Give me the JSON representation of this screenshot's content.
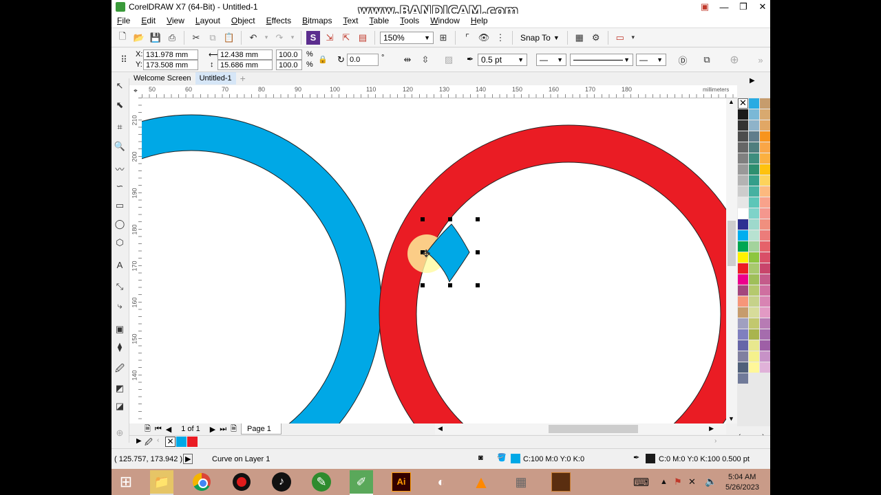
{
  "window": {
    "title": "CorelDRAW X7 (64-Bit) - Untitled-1"
  },
  "watermark": "www.BANDICAM.com",
  "menu": [
    "File",
    "Edit",
    "View",
    "Layout",
    "Object",
    "Effects",
    "Bitmaps",
    "Text",
    "Table",
    "Tools",
    "Window",
    "Help"
  ],
  "toolbar": {
    "zoom": "150%",
    "snap_to": "Snap To"
  },
  "properties": {
    "x_label": "X:",
    "x": "131.978 mm",
    "y_label": "Y:",
    "y": "173.508 mm",
    "width": "12.438 mm",
    "height": "15.686 mm",
    "scale_w": "100.0",
    "scale_h": "100.0",
    "pct": "%",
    "angle": "0.0",
    "deg": "°",
    "outline_width": "0.5 pt"
  },
  "tabs": [
    "Welcome Screen",
    "Untitled-1"
  ],
  "ruler": {
    "h_ticks": [
      "50",
      "60",
      "70",
      "80",
      "90",
      "100",
      "110",
      "120",
      "130",
      "140",
      "150",
      "160",
      "170",
      "180"
    ],
    "v_ticks": [
      "210",
      "200",
      "190",
      "180",
      "170",
      "160",
      "150",
      "140"
    ],
    "unit": "millimeters"
  },
  "page_nav": {
    "counter": "1 of 1",
    "page_tab": "Page 1"
  },
  "status": {
    "coords": "( 125.757, 173.942 )",
    "object": "Curve on Layer 1",
    "fill": "C:100 M:0 Y:0 K:0",
    "outline": "C:0 M:0 Y:0 K:100  0.500 pt"
  },
  "shapes": {
    "blue": "#00a8e6",
    "red": "#ea1c24"
  },
  "palette": {
    "col1": [
      "#1a1a1a",
      "#333333",
      "#4d4d4d",
      "#666666",
      "#808080",
      "#999999",
      "#b3b3b3",
      "#cccccc",
      "#e6e6e6",
      "#ffffff",
      "#2e3192",
      "#00aeef",
      "#00a651",
      "#fff200",
      "#ed1c24",
      "#ec008c",
      "#a3467d",
      "#f69679",
      "#c69c6d",
      "#a0a0c0",
      "#7f7fbf",
      "#6666a8",
      "#8080a0",
      "#50607a",
      "#707a99"
    ],
    "col2": [
      "#29abe2",
      "#7ab8d6",
      "#8fb3c9",
      "#607d8b",
      "#4f7e7e",
      "#3e8e7e",
      "#2d8f6f",
      "#349e8a",
      "#46b1a1",
      "#5cc6b8",
      "#7fd3c9",
      "#9ed9cc",
      "#b8e2d1",
      "#a3d39c",
      "#8dc63f",
      "#a8c96e",
      "#9fbf5a",
      "#b5c96e",
      "#c6d28a",
      "#d7dc9a",
      "#c2c86e",
      "#a9b44e",
      "#e8e88e",
      "#f5f18c",
      "#fff799"
    ],
    "col3": [
      "#c69c6d",
      "#d8a96f",
      "#e1a765",
      "#f7941d",
      "#f9a647",
      "#fbb040",
      "#ffc20e",
      "#fdd35c",
      "#fcb97f",
      "#f8a28b",
      "#f4978e",
      "#f08f7e",
      "#ec7c7a",
      "#e5626a",
      "#d94f67",
      "#c8456b",
      "#c45b8a",
      "#cf6fa0",
      "#d884b3",
      "#e29ac4",
      "#b77bb4",
      "#a56cad",
      "#9e5fa6",
      "#c792c7",
      "#e0b2d9"
    ]
  },
  "taskbar": {
    "time": "5:04 AM",
    "date": "5/26/2023"
  }
}
